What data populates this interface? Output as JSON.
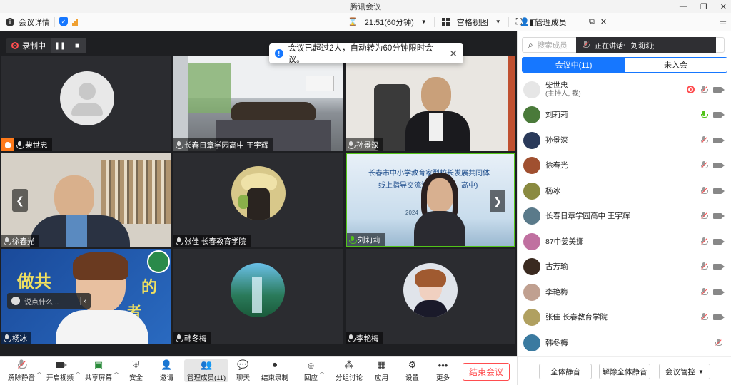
{
  "window": {
    "title": "腾讯会议"
  },
  "infobar": {
    "meeting_details": "会议详情",
    "timer": "21:51(60分钟)",
    "view_mode": "宫格视图",
    "manage_members": "管理成员"
  },
  "stage": {
    "recording_label": "录制中",
    "toast": "会议已超过2人，自动转为60分钟限时会议。",
    "chat_placeholder": "说点什么...",
    "tiles": [
      {
        "name": "柴世忠",
        "mic": "muted",
        "host": true,
        "kind": "avatar"
      },
      {
        "name": "长春日章学园高中 王宇辉",
        "mic": "muted",
        "kind": "room"
      },
      {
        "name": "孙景深",
        "mic": "muted",
        "kind": "person-suit"
      },
      {
        "name": "徐春光",
        "mic": "muted",
        "kind": "person-office"
      },
      {
        "name": "张佳 长春教育学院",
        "mic": "muted",
        "kind": "avatar-art"
      },
      {
        "name": "刘莉莉",
        "mic": "active",
        "kind": "presentation",
        "slide_text_1": "长春市中小学教育家型校长发展共同体",
        "slide_text_2": "线上指导交流活",
        "slide_text_3": "高中)",
        "slide_year": "2024"
      },
      {
        "name": "杨冰",
        "mic": "muted",
        "kind": "person-banner",
        "banner_text_1": "做共",
        "banner_text_2": "的",
        "banner_text_3": "者"
      },
      {
        "name": "韩冬梅",
        "mic": "muted",
        "kind": "avatar-landscape"
      },
      {
        "name": "李艳梅",
        "mic": "muted",
        "kind": "avatar-portrait"
      }
    ]
  },
  "toolbar": {
    "items": [
      {
        "label": "解除静音",
        "icon": "mic-muted-icon"
      },
      {
        "label": "开启视频",
        "icon": "camera-off-icon"
      },
      {
        "label": "共享屏幕",
        "icon": "share-screen-icon"
      },
      {
        "label": "安全",
        "icon": "shield-icon"
      },
      {
        "label": "邀请",
        "icon": "invite-icon"
      },
      {
        "label": "管理成员(11)",
        "icon": "members-icon"
      },
      {
        "label": "聊天",
        "icon": "chat-icon"
      },
      {
        "label": "结束录制",
        "icon": "stop-record-icon"
      },
      {
        "label": "回应",
        "icon": "reaction-icon"
      },
      {
        "label": "分组讨论",
        "icon": "breakout-icon"
      },
      {
        "label": "应用",
        "icon": "apps-icon"
      },
      {
        "label": "设置",
        "icon": "settings-icon"
      },
      {
        "label": "更多",
        "icon": "more-icon"
      }
    ],
    "end_meeting": "结束会议"
  },
  "panel": {
    "search_placeholder": "搜索成员",
    "speaking_prefix": "正在讲话:",
    "speaking_name": "刘莉莉;",
    "tab_in_meeting": "会议中(11)",
    "tab_not_joined": "未入会",
    "members": [
      {
        "name": "柴世忠",
        "sub": "(主持人, 我)",
        "mic": "muted",
        "rec": true,
        "color": "#d9d9d9"
      },
      {
        "name": "刘莉莉",
        "mic": "green",
        "color": "#4a7a3a"
      },
      {
        "name": "孙景深",
        "mic": "muted",
        "color": "#2a3a5a"
      },
      {
        "name": "徐春光",
        "mic": "muted",
        "color": "#a05030"
      },
      {
        "name": "杨冰",
        "mic": "muted",
        "color": "#8a8a40"
      },
      {
        "name": "长春日章学园高中 王宇辉",
        "mic": "muted",
        "color": "#5a7a8a"
      },
      {
        "name": "87中姜美娜",
        "mic": "muted",
        "color": "#c070a0"
      },
      {
        "name": "古芳瑜",
        "mic": "muted",
        "color": "#3a2a20"
      },
      {
        "name": "李艳梅",
        "mic": "muted",
        "color": "#c0a090"
      },
      {
        "name": "张佳 长春教育学院",
        "mic": "muted",
        "color": "#b0a060"
      },
      {
        "name": "韩冬梅",
        "mic": "muted",
        "color": "#3a7aa0",
        "no_cam": true
      }
    ],
    "mute_all": "全体静音",
    "unmute_all": "解除全体静音",
    "meeting_control": "会议管控"
  }
}
